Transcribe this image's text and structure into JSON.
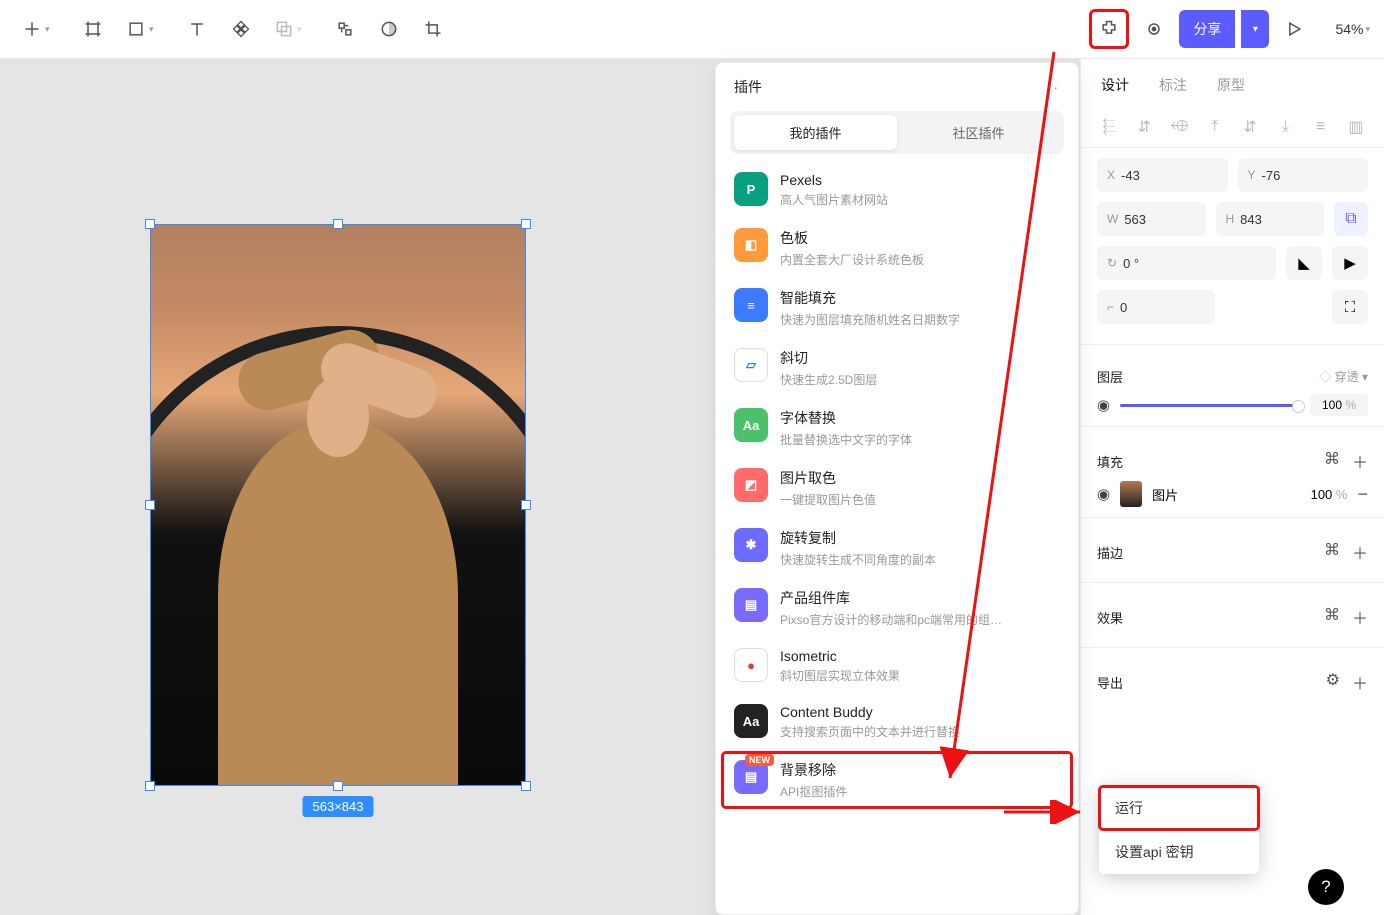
{
  "toolbar": {
    "share_label": "分享",
    "zoom": "54%"
  },
  "canvas": {
    "dimension_label": "563×843"
  },
  "plugin_panel": {
    "title": "插件",
    "tabs": {
      "mine": "我的插件",
      "community": "社区插件"
    },
    "items": [
      {
        "name": "Pexels",
        "desc": "高人气图片素材网站",
        "color": "#07a081",
        "glyph": "P"
      },
      {
        "name": "色板",
        "desc": "内置全套大厂设计系统色板",
        "color": "#ff9a3c",
        "glyph": "◧"
      },
      {
        "name": "智能填充",
        "desc": "快速为图层填充随机姓名日期数字",
        "color": "#3b7bff",
        "glyph": "≡"
      },
      {
        "name": "斜切",
        "desc": "快速生成2.5D图层",
        "color": "#ffffff",
        "glyph": "▱"
      },
      {
        "name": "字体替换",
        "desc": "批量替换选中文字的字体",
        "color": "#4ac26b",
        "glyph": "Aa"
      },
      {
        "name": "图片取色",
        "desc": "一键提取图片色值",
        "color": "#ff6b6b",
        "glyph": "◩"
      },
      {
        "name": "旋转复制",
        "desc": "快速旋转生成不同角度的副本",
        "color": "#6b6bff",
        "glyph": "✱"
      },
      {
        "name": "产品组件库",
        "desc": "Pixso官方设计的移动端和pc端常用的组…",
        "color": "#7a6bff",
        "glyph": "▤"
      },
      {
        "name": "Isometric",
        "desc": "斜切图层实现立体效果",
        "color": "#ffffff",
        "glyph": "●"
      },
      {
        "name": "Content Buddy",
        "desc": "支持搜索页面中的文本并进行替换",
        "color": "#222",
        "glyph": "Aa"
      },
      {
        "name": "背景移除",
        "desc": "API抠图插件",
        "color": "#7a6bff",
        "glyph": "▤",
        "new": "NEW"
      }
    ]
  },
  "inspector": {
    "tabs": {
      "design": "设计",
      "annotate": "标注",
      "proto": "原型"
    },
    "x": "-43",
    "y": "-76",
    "w": "563",
    "h": "843",
    "rotation": "0 °",
    "radius": "0",
    "layer_section": "图层",
    "blend": "穿透",
    "opacity": "100",
    "fill_section": "填充",
    "fill_type": "图片",
    "fill_opacity": "100",
    "stroke_section": "描边",
    "effects_section": "效果",
    "export_section": "导出",
    "pct": "%",
    "shortcut": "⌘"
  },
  "context_menu": {
    "run": "运行",
    "set_key": "设置api 密钥"
  },
  "help_badge": "?"
}
